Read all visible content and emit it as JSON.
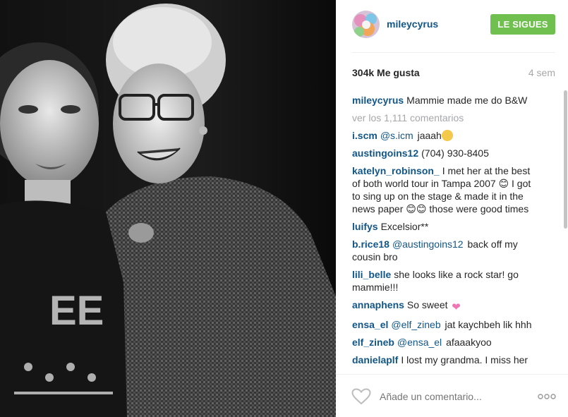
{
  "post": {
    "username": "mileycyrus",
    "follow_label": "LE SIGUES",
    "likes": "304k Me gusta",
    "age": "4 sem",
    "caption": "Mammie made me do B&W",
    "view_all": "ver los 1,111 comentarios"
  },
  "comments": [
    {
      "user": "i.scm",
      "mention": "@s.icm",
      "text": "jaaah",
      "emoji": "face"
    },
    {
      "user": "austingoins12",
      "mention": "",
      "text": "(704) 930-8405"
    },
    {
      "user": "katelyn_robinson_",
      "mention": "",
      "text": "I met her at the best of both world tour in Tampa 2007 😊 I got to sing up on the stage & made it in the news paper 😊😊 those were good times"
    },
    {
      "user": "luifys",
      "mention": "",
      "text": "Excelsior**"
    },
    {
      "user": "b.rice18",
      "mention": "@austingoins12",
      "text": "back off my cousin bro"
    },
    {
      "user": "lili_belle",
      "mention": "",
      "text": "she looks like a rock star! go mammie!!!"
    },
    {
      "user": "annaphens",
      "mention": "",
      "text": "So sweet",
      "emoji": "heart"
    },
    {
      "user": "ensa_el",
      "mention": "@elf_zineb",
      "text": "jat kaychbeh lik hhh"
    },
    {
      "user": "elf_zineb",
      "mention": "@ensa_el",
      "text": "afaaakyoo"
    },
    {
      "user": "danielaplf",
      "mention": "",
      "text": "I lost my grandma. I miss her"
    }
  ],
  "footer": {
    "comment_placeholder": "Añade un comentario..."
  },
  "icons": {
    "like": "heart-outline-icon",
    "more": "more-options-icon"
  },
  "colors": {
    "username": "#125688",
    "follow_button": "#70c050",
    "muted": "#a5a7aa"
  }
}
